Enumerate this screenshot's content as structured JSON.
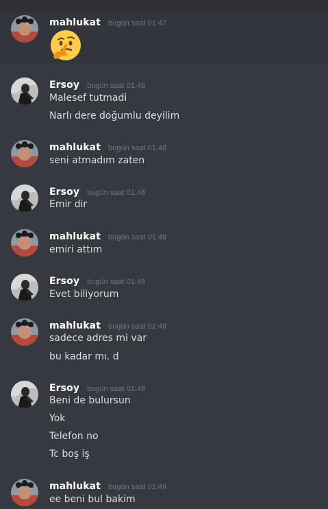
{
  "messages": [
    {
      "author": "mahlukat",
      "time": "bugün saat 01:47",
      "emoji_icon": "thinking-face-emoji",
      "lines": []
    },
    {
      "author": "Ersoy",
      "time": "bugün saat 01:48",
      "lines": [
        "Malesef tutmadi",
        "Narlı dere doğumlu deyilim"
      ]
    },
    {
      "author": "mahlukat",
      "time": "bugün saat 01:48",
      "lines": [
        "seni atmadım zaten"
      ]
    },
    {
      "author": "Ersoy",
      "time": "bugün saat 01:48",
      "lines": [
        "Emir dir"
      ]
    },
    {
      "author": "mahlukat",
      "time": "bugün saat 01:48",
      "lines": [
        "emiri attım"
      ]
    },
    {
      "author": "Ersoy",
      "time": "bugün saat 01:48",
      "lines": [
        "Evet biliyorum"
      ]
    },
    {
      "author": "mahlukat",
      "time": "bugün saat 01:48",
      "lines": [
        "sadece adres mi var",
        "bu kadar mı. d"
      ]
    },
    {
      "author": "Ersoy",
      "time": "bugün saat 01:48",
      "lines": [
        "Beni de bulursun",
        "Yok",
        "Telefon no",
        "Tc boş iş"
      ]
    },
    {
      "author": "mahlukat",
      "time": "bugün saat 01:49",
      "lines": [
        "ee beni bul bakim"
      ]
    }
  ],
  "colors": {
    "background": "#36393f",
    "username": "#ffffff",
    "text": "#dcddde",
    "timestamp": "#72767d"
  }
}
